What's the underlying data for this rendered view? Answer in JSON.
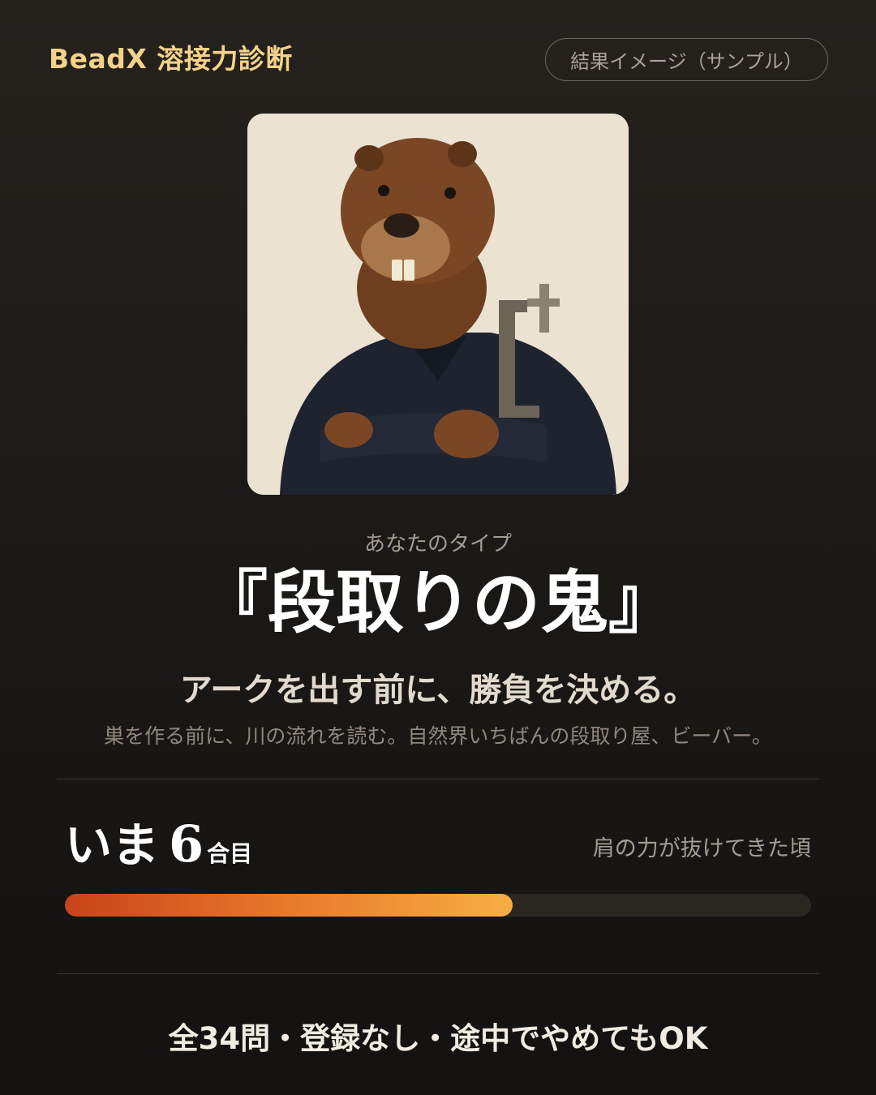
{
  "header": {
    "brand": "BeadX 溶接力診断",
    "sample_label": "結果イメージ（サンプル）"
  },
  "result": {
    "type_label": "あなたのタイプ",
    "type_name": "『段取りの鬼』",
    "tagline": "アークを出す前に、勝負を決める。",
    "description": "巣を作る前に、川の流れを読む。自然界いちばんの段取り屋、ビーバー。"
  },
  "level": {
    "prefix": "いま",
    "number": "6",
    "unit": "合目",
    "caption": "肩の力が抜けてきた頃",
    "progress_fraction": 0.6
  },
  "footer": {
    "note": "全34問・登録なし・途中でやめてもOK"
  },
  "colors": {
    "brand": "#f5d28a",
    "progress_start": "#c8431a",
    "progress_end": "#f7ae45",
    "background": "#1c1a17"
  },
  "icons": {
    "portrait": "beaver-welder-illustration"
  }
}
